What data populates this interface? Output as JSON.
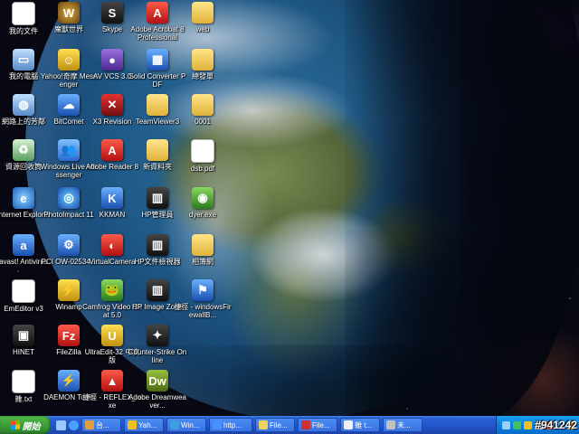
{
  "desktop": {
    "icons": [
      {
        "label": "我的文件",
        "glyph": "▤",
        "icon": "my-documents-icon"
      },
      {
        "label": "我的電腦",
        "glyph": "▭",
        "icon": "my-computer-icon"
      },
      {
        "label": "網路上的芳鄰",
        "glyph": "◍",
        "icon": "network-places-icon"
      },
      {
        "label": "資源回收筒",
        "glyph": "♻",
        "icon": "recycle-bin-icon"
      },
      {
        "label": "Internet Explorer",
        "glyph": "e",
        "icon": "internet-explorer-icon"
      },
      {
        "label": "avast! Antivirus",
        "glyph": "a",
        "icon": "avast-antivirus-icon"
      },
      {
        "label": "EmEditor v3",
        "glyph": "✎",
        "icon": "emeditor-icon"
      },
      {
        "label": "HINET",
        "glyph": "▣",
        "icon": "hinet-icon"
      },
      {
        "label": "雜.txt",
        "glyph": "txt",
        "icon": "text-file-icon"
      },
      {
        "label": "魔獸世界",
        "glyph": "W",
        "icon": "world-of-warcraft-icon"
      },
      {
        "label": "Yahoo!奇摩 Messenger",
        "glyph": "☺",
        "icon": "yahoo-messenger-icon"
      },
      {
        "label": "BitComet",
        "glyph": "☁",
        "icon": "bitcomet-icon"
      },
      {
        "label": "Windows Live Messenger",
        "glyph": "👥",
        "icon": "windows-live-messenger-icon"
      },
      {
        "label": "PhotoImpact 11",
        "glyph": "◎",
        "icon": "photoimpact-icon"
      },
      {
        "label": "PCI OW-02534...",
        "glyph": "⚙",
        "icon": "pci-device-icon"
      },
      {
        "label": "Winamp",
        "glyph": "⚡",
        "icon": "winamp-icon"
      },
      {
        "label": "FileZilla",
        "glyph": "Fz",
        "icon": "filezilla-icon"
      },
      {
        "label": "DAEMON Tools",
        "glyph": "⚡",
        "icon": "daemon-tools-icon"
      },
      {
        "label": "Skype",
        "glyph": "S",
        "icon": "skype-icon"
      },
      {
        "label": "AV VCS 3.0",
        "glyph": "●",
        "icon": "av-vcs-icon"
      },
      {
        "label": "X3 Revision",
        "glyph": "✕",
        "icon": "x3-revision-icon"
      },
      {
        "label": "Adobe Reader 8",
        "glyph": "A",
        "icon": "adobe-reader-icon"
      },
      {
        "label": "KKMAN",
        "glyph": "K",
        "icon": "kkman-icon"
      },
      {
        "label": "VirtualCamera",
        "glyph": "◐",
        "icon": "virtual-camera-icon"
      },
      {
        "label": "Camfrog Video Chat 5.0",
        "glyph": "🐸",
        "icon": "camfrog-icon"
      },
      {
        "label": "UltraEdit-32 中文版",
        "glyph": "U",
        "icon": "ultraedit-icon"
      },
      {
        "label": "捷徑 - REFLEX_.exe",
        "glyph": "▲",
        "icon": "reflex-shortcut-icon"
      },
      {
        "label": "Adobe Acrobat 8 Professional",
        "glyph": "A",
        "icon": "adobe-acrobat-icon"
      },
      {
        "label": "Solid Converter PDF",
        "glyph": "▦",
        "icon": "solid-converter-icon"
      },
      {
        "label": "TeamViewer3",
        "glyph": "",
        "icon": "folder-icon"
      },
      {
        "label": "新資料夾",
        "glyph": "",
        "icon": "folder-icon"
      },
      {
        "label": "HP管理員",
        "glyph": "▥",
        "icon": "hp-manager-icon"
      },
      {
        "label": "HP文件檢視器",
        "glyph": "▥",
        "icon": "hp-document-viewer-icon"
      },
      {
        "label": "HP Image Zone",
        "glyph": "▥",
        "icon": "hp-image-zone-icon"
      },
      {
        "label": "Counter-Strike Online",
        "glyph": "✦",
        "icon": "counter-strike-icon"
      },
      {
        "label": "Adobe Dreamweaver...",
        "glyph": "Dw",
        "icon": "dreamweaver-icon"
      },
      {
        "label": "web",
        "glyph": "",
        "icon": "folder-icon"
      },
      {
        "label": "總發單",
        "glyph": "",
        "icon": "folder-icon"
      },
      {
        "label": "0001",
        "glyph": "",
        "icon": "folder-icon"
      },
      {
        "label": "dsb.pdf",
        "glyph": "PDF",
        "icon": "pdf-file-icon"
      },
      {
        "label": "dyer.exe",
        "glyph": "◉",
        "icon": "eye-app-icon"
      },
      {
        "label": "相簿網",
        "glyph": "",
        "icon": "folder-icon"
      },
      {
        "label": "捷徑 - windowsFirewallB...",
        "glyph": "⚑",
        "icon": "firewall-shortcut-icon"
      }
    ]
  },
  "taskbar": {
    "start_label": "開始",
    "tasks": [
      {
        "label": "台...",
        "icon": "window-icon"
      },
      {
        "label": "Yah...",
        "icon": "yahoo-icon"
      },
      {
        "label": "Win...",
        "icon": "messenger-icon"
      },
      {
        "label": "http...",
        "icon": "ie-icon"
      },
      {
        "label": "File...",
        "icon": "folder-icon"
      },
      {
        "label": "File...",
        "icon": "filezilla-icon"
      },
      {
        "label": "雜 t...",
        "icon": "notepad-icon"
      },
      {
        "label": "未...",
        "icon": "editor-icon"
      }
    ],
    "tray_icons": [
      "network-icon",
      "msn-icon",
      "yahoo-tray-icon",
      "volume-icon",
      "antivirus-tray-icon",
      "update-icon",
      "shield-icon"
    ]
  },
  "watermark": "#941242",
  "colors": {
    "taskbar": "#2353c8",
    "start_button": "#3a9a35",
    "tray": "#0c80de"
  }
}
